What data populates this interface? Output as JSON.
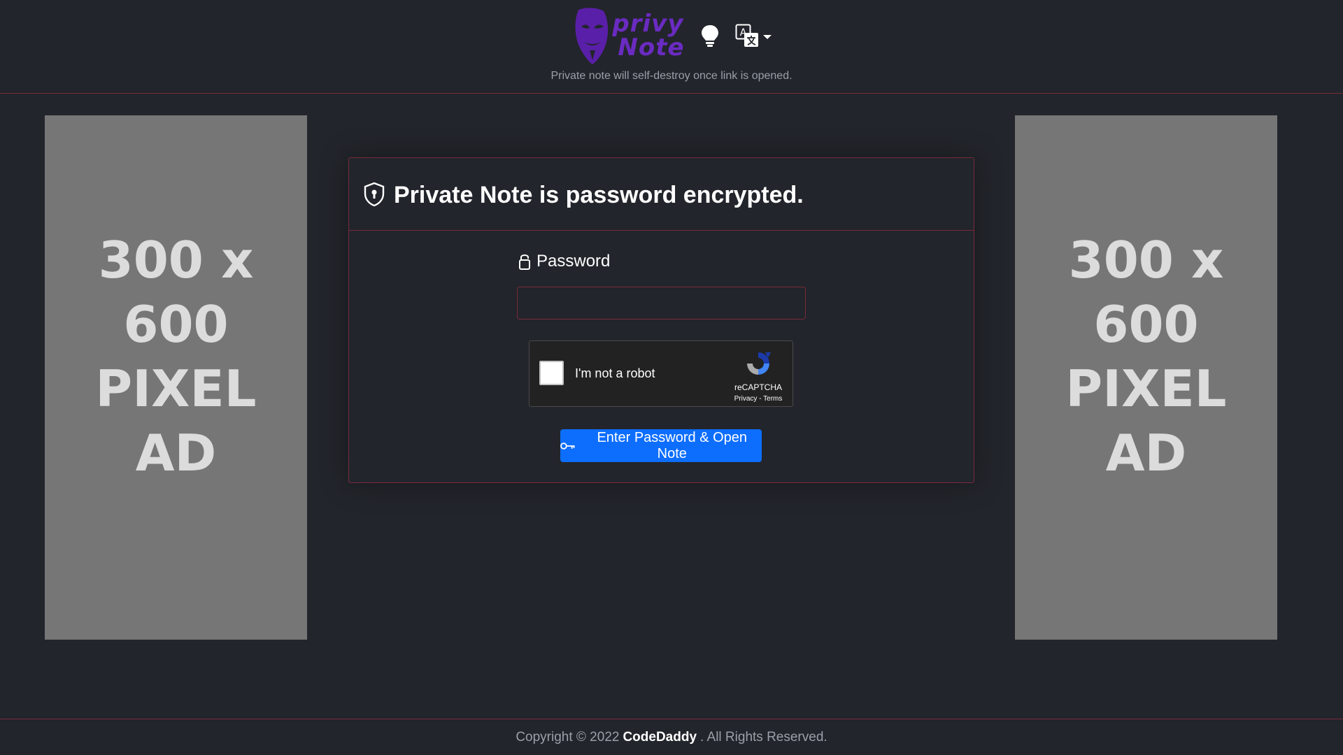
{
  "header": {
    "logo_text_line1": "privy",
    "logo_text_line2": "Note",
    "tagline": "Private note will self-destroy once link is opened.",
    "theme_icon": "lightbulb-icon",
    "language_icon": "translate-icon"
  },
  "ads": {
    "left": {
      "line1": "300 x 600",
      "line2": "PIXEL",
      "line3": "AD"
    },
    "right": {
      "line1": "300 x 600",
      "line2": "PIXEL",
      "line3": "AD"
    }
  },
  "card": {
    "title": "Private Note is password encrypted.",
    "title_icon": "shield-lock-icon",
    "password_label": "Password",
    "password_icon": "lock-icon",
    "password_value": "",
    "captcha": {
      "label": "I'm not a robot",
      "brand": "reCAPTCHA",
      "privacy": "Privacy",
      "separator": " - ",
      "terms": "Terms"
    },
    "submit_label": "Enter Password & Open Note",
    "submit_icon": "key-icon"
  },
  "footer": {
    "prefix": "Copyright © 2022",
    "brand": "CodeDaddy",
    "suffix": ". All Rights Reserved."
  },
  "colors": {
    "background": "#22252b",
    "border": "#7a2a3c",
    "accent": "#0d6efd",
    "logo": "#6a2bc1",
    "ad": "#767676"
  }
}
